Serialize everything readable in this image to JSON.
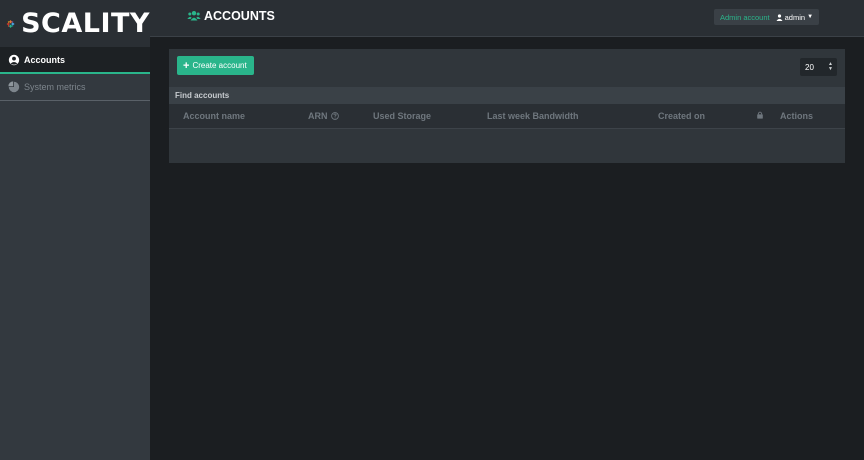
{
  "brand": {
    "name": "SCALITY"
  },
  "sidebar": {
    "items": [
      {
        "label": "Accounts",
        "icon": "user-circle-icon",
        "active": true
      },
      {
        "label": "System metrics",
        "icon": "pie-chart-icon",
        "active": false
      }
    ]
  },
  "header": {
    "title": "ACCOUNTS",
    "title_icon": "users-icon",
    "user_role": "Admin account",
    "user_name": "admin"
  },
  "toolbar": {
    "create_label": "Create account",
    "page_size": "20"
  },
  "table": {
    "filter_label": "Find accounts",
    "columns": [
      "Account name",
      "ARN",
      "Used Storage",
      "Last week Bandwidth",
      "Created on",
      "",
      "Actions"
    ]
  },
  "colors": {
    "accent": "#2ab58b",
    "sidebar_bg": "#33393f",
    "topbar_bg": "#2a2f34",
    "page_bg": "#1b1e21"
  }
}
